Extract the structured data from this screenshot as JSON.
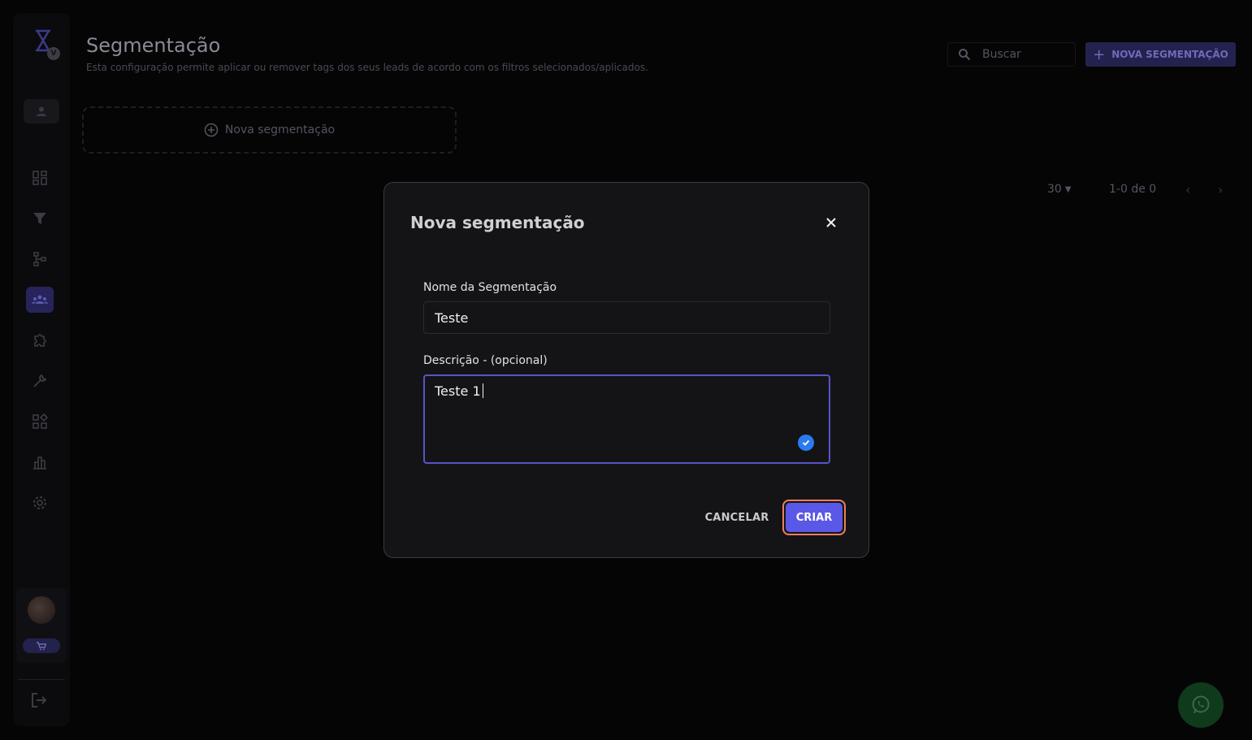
{
  "page": {
    "title": "Segmentação",
    "subtitle": "Esta configuração permite aplicar ou remover tags dos seus leads de acordo com os filtros selecionados/aplicados."
  },
  "search": {
    "placeholder": "Buscar"
  },
  "new_button": {
    "label": "NOVA SEGMENTAÇÃO"
  },
  "new_card": {
    "label": "Nova segmentação"
  },
  "pagination": {
    "per_page": "30",
    "range": "1-0 de 0"
  },
  "sidebar": {
    "items": [
      {
        "icon": "dashboard-icon"
      },
      {
        "icon": "filter-icon"
      },
      {
        "icon": "flow-icon"
      },
      {
        "icon": "segmentation-icon",
        "active": true
      },
      {
        "icon": "puzzle-icon"
      },
      {
        "icon": "tools-icon"
      },
      {
        "icon": "apps-icon"
      },
      {
        "icon": "chart-icon"
      },
      {
        "icon": "gear-icon"
      }
    ]
  },
  "modal": {
    "title": "Nova segmentação",
    "name_label": "Nome da Segmentação",
    "name_value": "Teste",
    "description_label": "Descrição - (opcional)",
    "description_value": "Teste 1",
    "cancel_label": "CANCELAR",
    "submit_label": "CRIAR"
  },
  "colors": {
    "accent": "#5a58e6",
    "focus_outline": "#ef7f5d",
    "whatsapp": "#0f3a1c"
  }
}
